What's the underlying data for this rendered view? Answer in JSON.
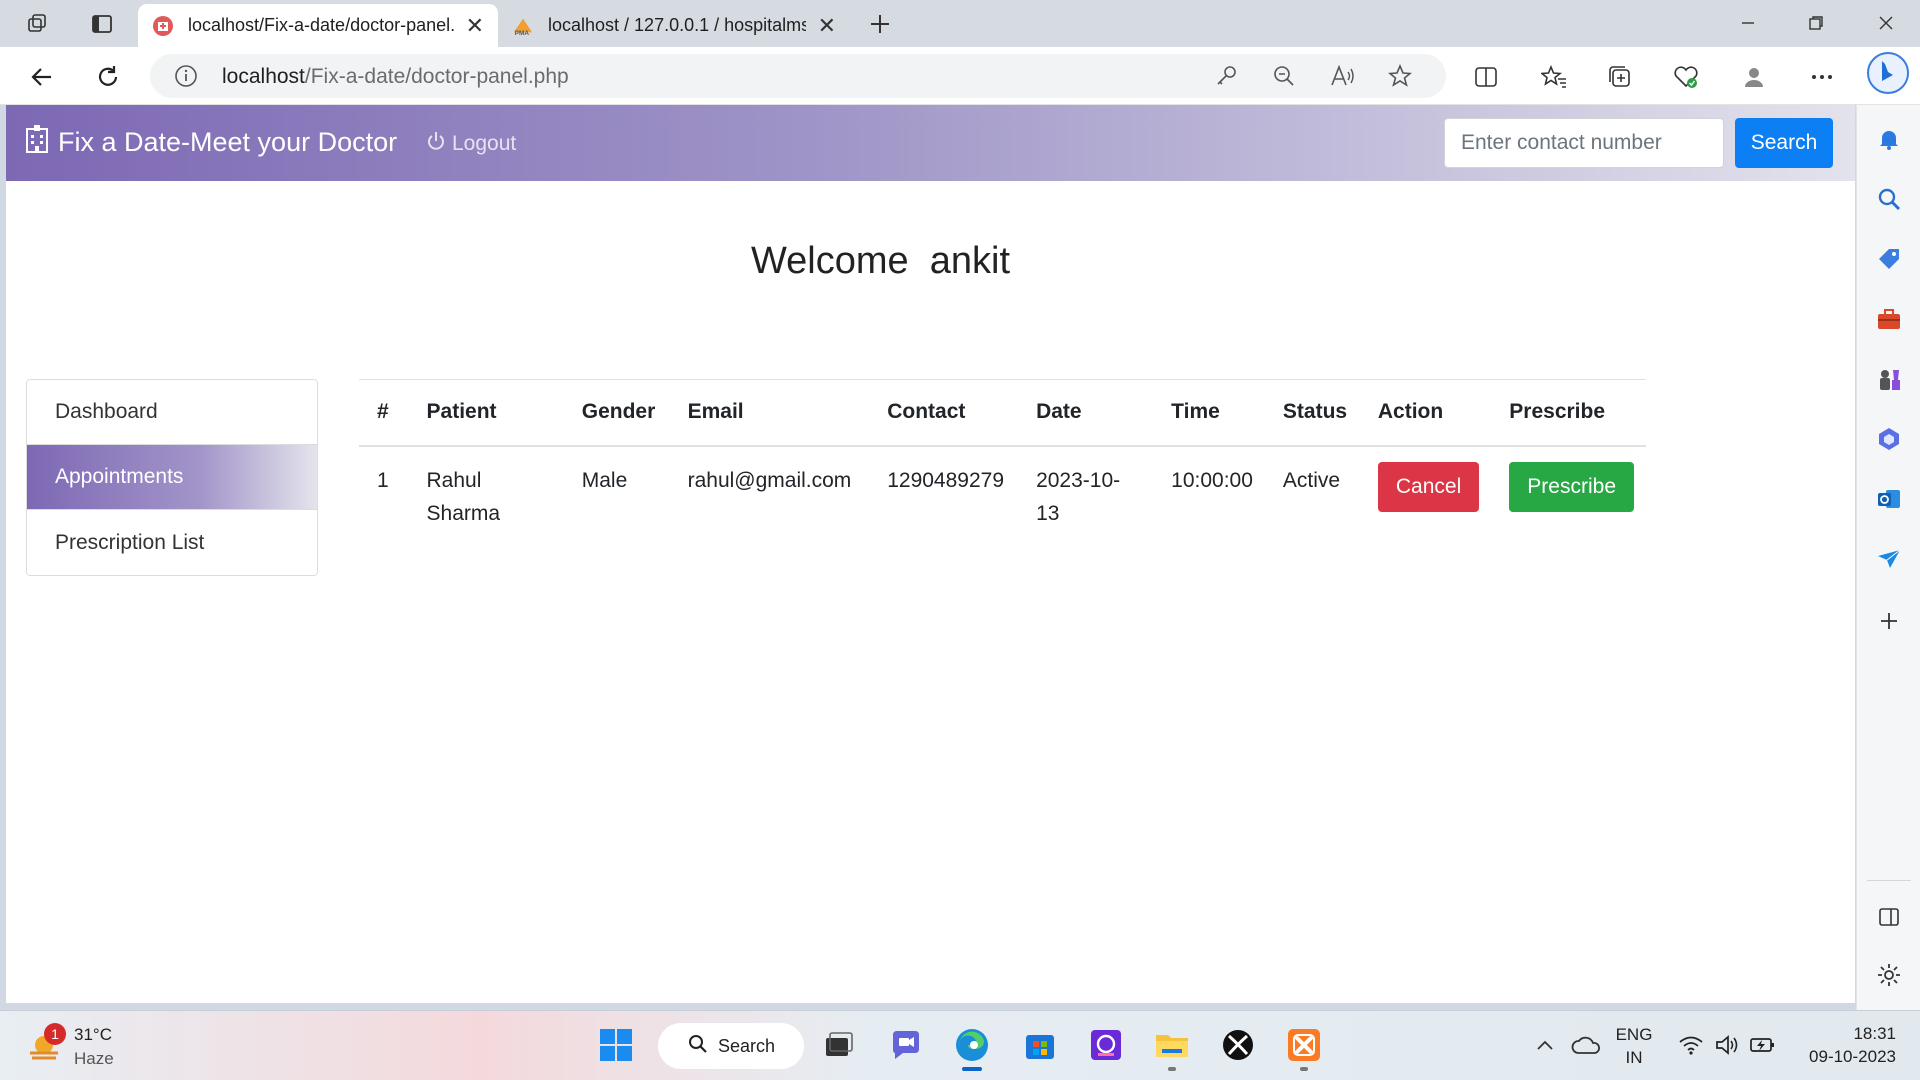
{
  "browser": {
    "tabs": [
      {
        "title": "localhost/Fix-a-date/doctor-panel.php",
        "active": true
      },
      {
        "title": "localhost / 127.0.0.1 / hospitalms",
        "active": false
      }
    ],
    "url_host": "localhost",
    "url_path": "/Fix-a-date/doctor-panel.php"
  },
  "site": {
    "brand": "Fix a Date-Meet your Doctor",
    "logout": "Logout",
    "search_placeholder": "Enter contact number",
    "search_button": "Search",
    "accent": "#7d68b4"
  },
  "welcome": {
    "prefix": "Welcome",
    "name": "ankit"
  },
  "sidebar": {
    "items": [
      {
        "label": "Dashboard",
        "active": false
      },
      {
        "label": "Appointments",
        "active": true
      },
      {
        "label": "Prescription List",
        "active": false
      }
    ]
  },
  "table": {
    "headers": [
      "#",
      "Patient",
      "Gender",
      "Email",
      "Contact",
      "Date",
      "Time",
      "Status",
      "Action",
      "Prescribe"
    ],
    "rows": [
      {
        "num": "1",
        "patient": "Rahul Sharma",
        "gender": "Male",
        "email": "rahul@gmail.com",
        "contact": "1290489279",
        "date": "2023-10-13",
        "time": "10:00:00",
        "status": "Active",
        "action": "Cancel",
        "prescribe": "Prescribe"
      }
    ]
  },
  "taskbar": {
    "weather_temp": "31°C",
    "weather_desc": "Haze",
    "weather_badge": "1",
    "search": "Search",
    "lang_line1": "ENG",
    "lang_line2": "IN",
    "time": "18:31",
    "date": "09-10-2023"
  },
  "colors": {
    "cancel": "#dc3545",
    "prescribe": "#28a745",
    "search_button": "#0d7ff5"
  }
}
